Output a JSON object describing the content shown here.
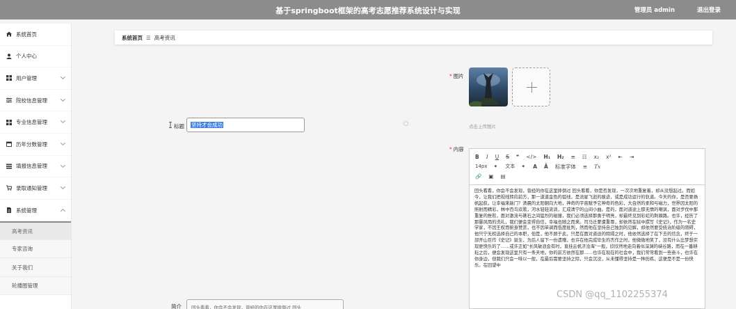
{
  "header": {
    "title": "基于springboot框架的高考志愿推荐系统设计与实现",
    "admin": "管理员 admin",
    "logout": "退出登录"
  },
  "sidebar": {
    "items": [
      {
        "label": "系统首页",
        "icon": "home-icon"
      },
      {
        "label": "个人中心",
        "icon": "user-icon"
      },
      {
        "label": "用户管理",
        "icon": "grid-icon"
      },
      {
        "label": "院校信息管理",
        "icon": "sliders-icon"
      },
      {
        "label": "专业信息管理",
        "icon": "grid-icon"
      },
      {
        "label": "历年分数管理",
        "icon": "calendar-icon"
      },
      {
        "label": "填报信息管理",
        "icon": "list-icon"
      },
      {
        "label": "录取通知管理",
        "icon": "cart-icon"
      },
      {
        "label": "系统管理",
        "icon": "document-icon"
      }
    ],
    "subitems": [
      "高考资讯",
      "专家咨询",
      "关于我们",
      "轮播图管理"
    ]
  },
  "breadcrumb": {
    "home": "系统首页",
    "separator": "☰",
    "current": "高考资讯"
  },
  "form": {
    "title_label": "标题",
    "title_value": "坚持才会成功",
    "image_label": "图片",
    "upload_tip": "点击上传图片",
    "content_label": "内容",
    "intro_label": "简介",
    "intro_value": "回头看看，你会不会发现，曾经的你在这里摔倒过 回头"
  },
  "editor": {
    "row1": [
      "B",
      "I",
      "U",
      "S",
      "❞",
      "</>",
      "H₁",
      "H₂",
      "≡",
      "☷",
      "x₂",
      "x²",
      "⇤",
      "⇥"
    ],
    "size": "14px",
    "text_style": "文本",
    "row2_icons": [
      "A",
      "Ā",
      "标准字体",
      "≡",
      "Tx"
    ],
    "row3": [
      "🔗",
      "▣",
      "▤"
    ],
    "content": "回头看看，你会不会发现，曾经的你在这里摔倒过 回头看看，你是否发现，一次次地重复着，却从没想起过。而如今，让我们把视线转向前方，那一道道金色的弧线，是流星飞逝的痕迹，或是成功运行的轨道。今天的你，是否要扬帆起航，让幸福来敲门？清晨的太阳朝向大地，神奇的宇宙赋予它神奇的色彩，大自然的柔和与磁力，世界因太阳的照射而精彩，林中百鸟欢歌，河水轻轻流淌，汇成清宁的山间小曲。是的，面对道途上那无情的嘲讽，面对步伐中那重复的挫败，面对激流与礁石之间猛烈的碰撞，我们必须选择那勇于明亮，却最终见到彩虹的荆棘路。也许，经历了那暴风雨的洗礼，我们便会变得自信，幸福也随之而来。司马迁蒙遭重辱，却依然在狱中撰写《史记》，作为一名史学家，不因王权而俯身赞赏，也不因单调而低度批判，然而他在坚持自己独到的见解，却依然要受统治阶级的阻碍，他只宁无权选择自己的本职，但是，他不顾于此，只是在面对道途的阻隔之时，他依然选择了在下去的信念，终于一部开山巨作《史记》诞生，为后人留下一份遗赠，也许在他完成毕生的杰作之时，他微微地笑了，没有什么比梦想实现更快乐的了……或许正如\"长风破浪会有时，直挂云帆济沧海\"一般，欣欣然地走向着似深渊的峡谷路，而在一番耕耘之后，便会发现这里只有一条天地，你的前方依然在那……也许在现在的社会中，我们常常看到一些奋斗，也许在你身边，但我们只会一味以一般，在最后需要坚持之际，只会沉没，从未懂得坚持是一种历练，这便是不是一份快乐。在回望中"
  },
  "watermark": "CSDN @qq_1102255374"
}
